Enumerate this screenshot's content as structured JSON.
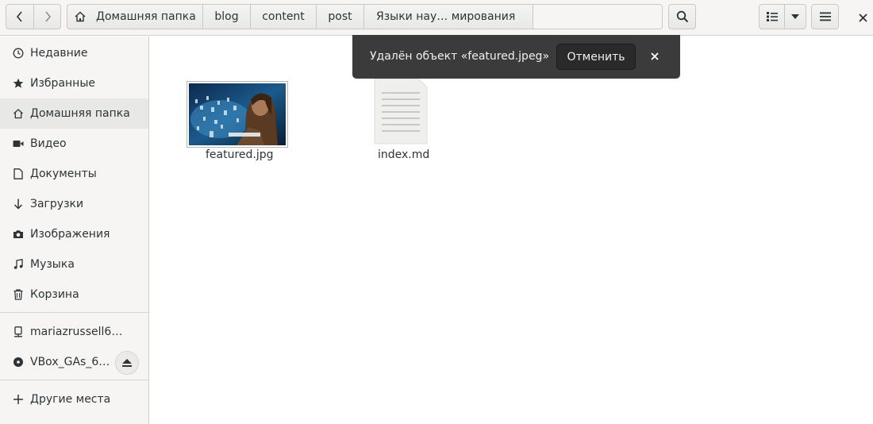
{
  "pathbar": {
    "crumbs": [
      "Домашняя папка",
      "blog",
      "content",
      "post",
      "Языки нау… мирования"
    ]
  },
  "sidebar": {
    "items": [
      {
        "label": "Недавние",
        "icon": "clock-icon"
      },
      {
        "label": "Избранные",
        "icon": "star-icon"
      },
      {
        "label": "Домашняя папка",
        "icon": "home-icon"
      },
      {
        "label": "Видео",
        "icon": "video-icon"
      },
      {
        "label": "Документы",
        "icon": "document-icon"
      },
      {
        "label": "Загрузки",
        "icon": "download-icon"
      },
      {
        "label": "Изображения",
        "icon": "camera-icon"
      },
      {
        "label": "Музыка",
        "icon": "music-icon"
      },
      {
        "label": "Корзина",
        "icon": "trash-icon"
      }
    ],
    "devices": [
      {
        "label": "mariazrussell6@…",
        "icon": "network-drive-icon"
      },
      {
        "label": "VBox_GAs_6.…",
        "icon": "optical-disc-icon"
      }
    ],
    "other_places": {
      "label": "Другие места",
      "icon": "plus-icon"
    }
  },
  "files": [
    {
      "name": "featured.jpg",
      "type": "image"
    },
    {
      "name": "index.md",
      "type": "text"
    }
  ],
  "toast": {
    "message": "Удалён объект «featured.jpeg»",
    "undo_label": "Отменить"
  }
}
